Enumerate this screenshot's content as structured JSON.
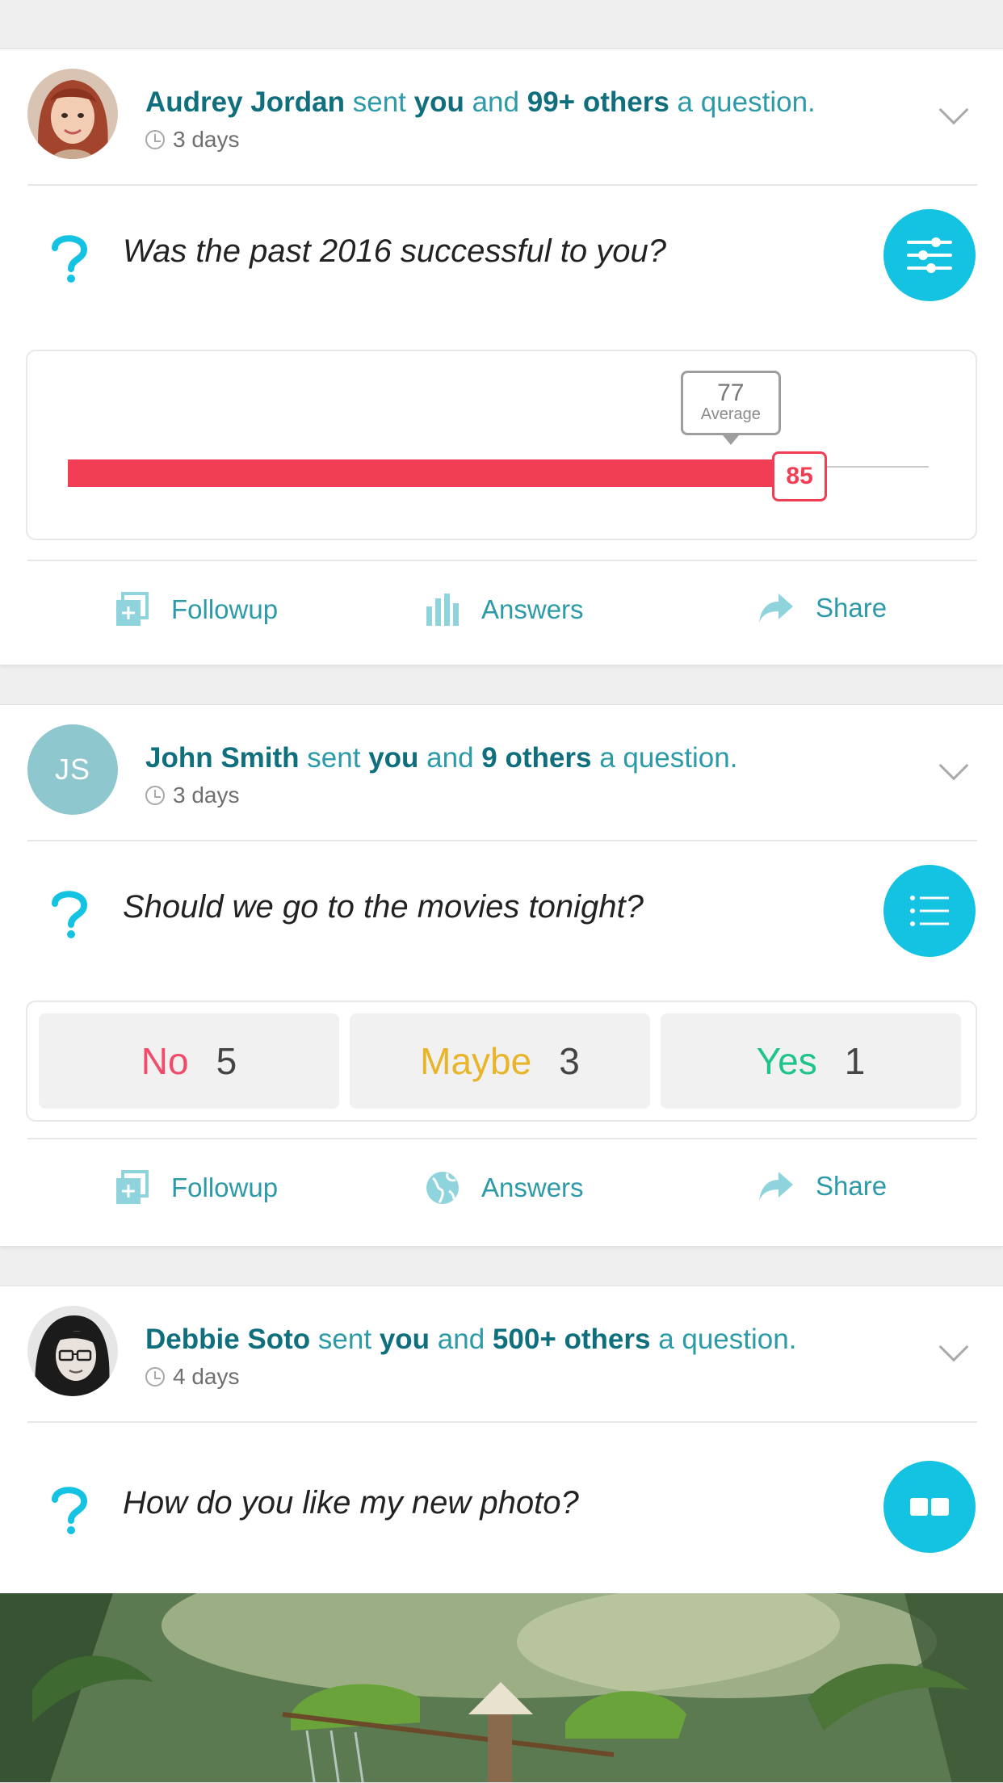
{
  "colors": {
    "accent": "#14c2e2",
    "name_teal": "#0f6f7c",
    "slider_red": "#f23e55",
    "no_color": "#f24a6a",
    "maybe_color": "#e8b52a",
    "yes_color": "#1fc48a"
  },
  "cards": [
    {
      "sender": "Audrey Jordan",
      "sent_word": "sent",
      "you": "you",
      "and_word": "and",
      "others": "99+ others",
      "tail": "a question.",
      "time": "3 days",
      "question": "Was the past 2016 successful to you?",
      "type_icon": "sliders-icon",
      "slider": {
        "value": 85,
        "value_label": "85",
        "average": 77,
        "average_label": "77",
        "average_caption": "Average",
        "min": 0,
        "max": 100
      },
      "actions": [
        {
          "label": "Followup",
          "icon": "followup-icon"
        },
        {
          "label": "Answers",
          "icon": "bar-chart-icon"
        },
        {
          "label": "Share",
          "icon": "share-arrow-icon"
        }
      ]
    },
    {
      "sender": "John Smith",
      "initials": "JS",
      "sent_word": "sent",
      "you": "you",
      "and_word": "and",
      "others": "9 others",
      "tail": "a question.",
      "time": "3 days",
      "question": "Should we go to the movies tonight?",
      "type_icon": "list-icon",
      "options": [
        {
          "label": "No",
          "count": "5"
        },
        {
          "label": "Maybe",
          "count": "3"
        },
        {
          "label": "Yes",
          "count": "1"
        }
      ],
      "actions": [
        {
          "label": "Followup",
          "icon": "followup-icon"
        },
        {
          "label": "Answers",
          "icon": "globe-icon"
        },
        {
          "label": "Share",
          "icon": "share-arrow-icon"
        }
      ]
    },
    {
      "sender": "Debbie Soto",
      "sent_word": "sent",
      "you": "you",
      "and_word": "and",
      "others": "500+ others",
      "tail": "a question.",
      "time": "4 days",
      "question": "How do you like my new photo?",
      "type_icon": "photo-compare-icon"
    }
  ]
}
